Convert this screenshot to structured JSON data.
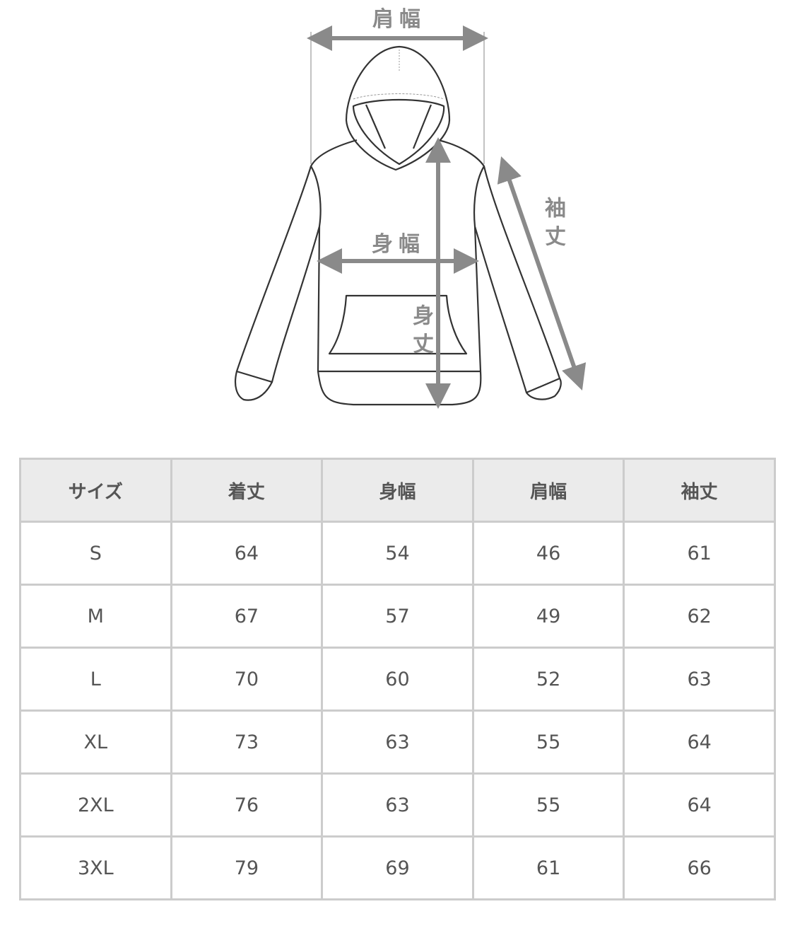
{
  "diagram": {
    "labels": {
      "shoulder_width": "肩幅",
      "body_width": "身幅",
      "body_length": "身丈",
      "sleeve_length": "袖丈"
    },
    "arrow_color": "#8a8a8a",
    "line_color": "#333333"
  },
  "table": {
    "headers": [
      "サイズ",
      "着丈",
      "身幅",
      "肩幅",
      "袖丈"
    ],
    "rows": [
      [
        "S",
        "64",
        "54",
        "46",
        "61"
      ],
      [
        "M",
        "67",
        "57",
        "49",
        "62"
      ],
      [
        "L",
        "70",
        "60",
        "52",
        "63"
      ],
      [
        "XL",
        "73",
        "63",
        "55",
        "64"
      ],
      [
        "2XL",
        "76",
        "63",
        "55",
        "64"
      ],
      [
        "3XL",
        "79",
        "69",
        "61",
        "66"
      ]
    ],
    "header_bg": "#ebebeb",
    "border_color": "#cccccc"
  }
}
